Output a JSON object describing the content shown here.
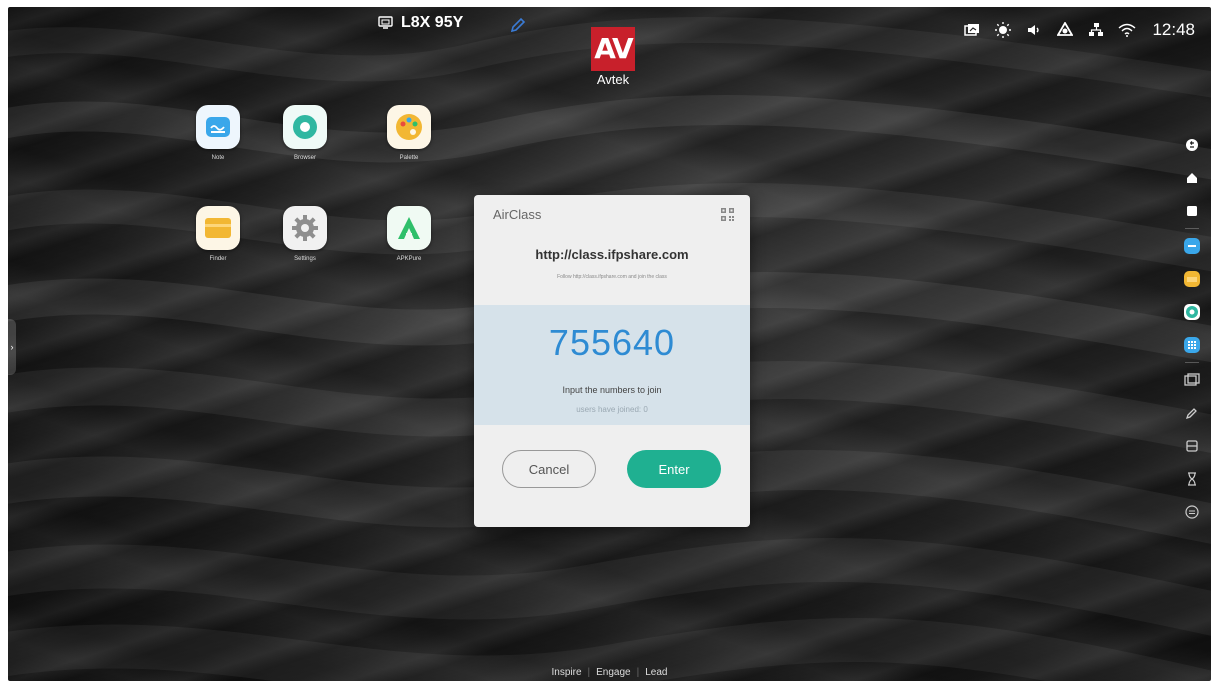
{
  "status_bar": {
    "room_code": "L8X 95Y",
    "time": "12:48",
    "icons": [
      "screen-share-icon",
      "brightness-icon",
      "volume-icon",
      "cloud-icon",
      "network-icon",
      "wifi-icon"
    ]
  },
  "logo": {
    "text": "Avtek"
  },
  "apps": [
    {
      "label": "Note",
      "icon": "note-icon",
      "color": "#3aa7ea"
    },
    {
      "label": "Browser",
      "icon": "browser-icon",
      "color": "#2fb7a1"
    },
    {
      "label": "Palette",
      "icon": "palette-icon",
      "color": "#f2b733"
    },
    {
      "label": "Finder",
      "icon": "finder-icon",
      "color": "#f2b733"
    },
    {
      "label": "Settings",
      "icon": "settings-icon",
      "color": "#8e8e8e"
    },
    {
      "label": "APKPure",
      "icon": "apkpure-icon",
      "color": "#2fbf6a"
    }
  ],
  "dialog": {
    "title": "AirClass",
    "url": "http://class.ifpshare.com",
    "hint": "Follow http://class.ifpshare.com and join the class",
    "code": "755640",
    "input_hint": "Input the numbers to join",
    "joined": "users have joined: 0",
    "cancel_label": "Cancel",
    "enter_label": "Enter"
  },
  "footer": {
    "items": [
      "Inspire",
      "Engage",
      "Lead"
    ]
  },
  "colors": {
    "accent": "#1fb091",
    "code": "#2e8bd3",
    "brand": "#c8202b"
  }
}
